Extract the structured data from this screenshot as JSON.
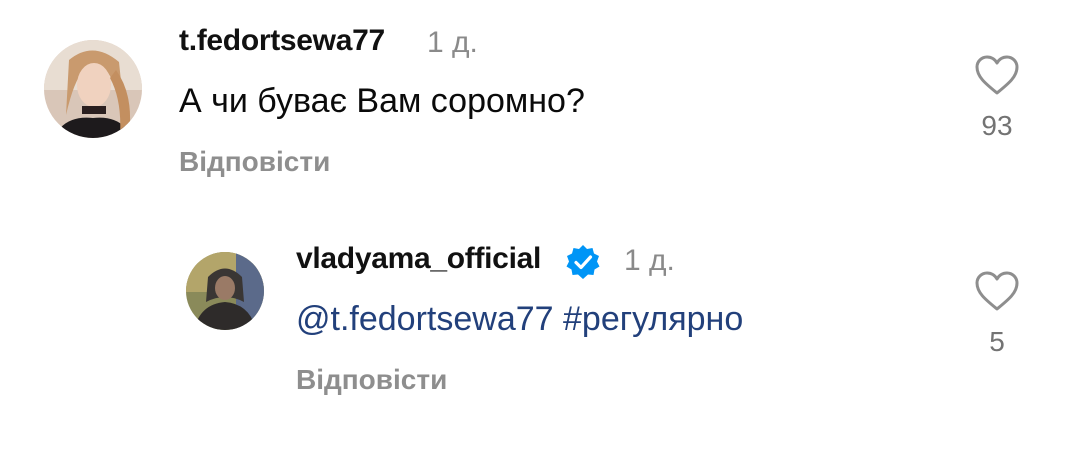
{
  "comments": [
    {
      "username": "t.fedortsewa77",
      "time": "1 д.",
      "text": "А чи буває Вам соромно?",
      "reply_label": "Відповісти",
      "likes": "93",
      "avatar_icon": "user-avatar-photo",
      "verified": false
    },
    {
      "username": "vladyama_official",
      "time": "1 д.",
      "mention": "@t.fedortsewa77",
      "hashtag": "#регулярно",
      "reply_label": "Відповісти",
      "likes": "5",
      "avatar_icon": "user-avatar-photo",
      "verified": true
    }
  ],
  "colors": {
    "link": "#22407b",
    "secondary": "#8e8e8e",
    "verified": "#0095f6"
  }
}
